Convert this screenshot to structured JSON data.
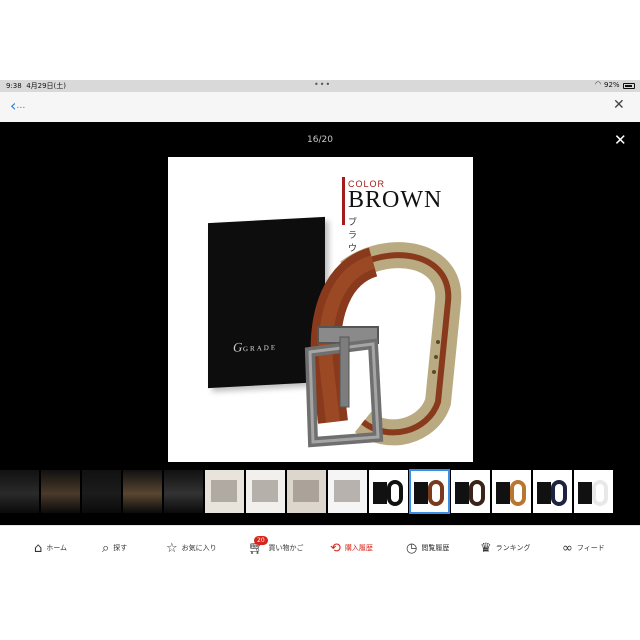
{
  "status_bar": {
    "time": "9:38",
    "date": "4月29日(土)",
    "battery": "92%",
    "battery_level": 0.92
  },
  "nav": {
    "back_label": "‹",
    "more_label": "…",
    "close_label": "✕"
  },
  "viewer": {
    "counter": "16/20",
    "close_label": "✕",
    "product": {
      "color_word": "COLOR",
      "color_name": "BROWN",
      "color_kana": "ブラウン",
      "box_brand": "GRADE",
      "box_brand_initial": "G",
      "colors": {
        "accent": "#a31d1d",
        "belt": "#8a3a1c",
        "buckle": "#7a7a7a"
      }
    },
    "thumbnails": [
      {
        "name": "lifestyle-1"
      },
      {
        "name": "lifestyle-2"
      },
      {
        "name": "lifestyle-3"
      },
      {
        "name": "lifestyle-4"
      },
      {
        "name": "lifestyle-5"
      },
      {
        "name": "detail-1"
      },
      {
        "name": "detail-2"
      },
      {
        "name": "detail-3"
      },
      {
        "name": "detail-4"
      },
      {
        "name": "color-black"
      },
      {
        "name": "color-brown",
        "selected": true
      },
      {
        "name": "color-dark-brown"
      },
      {
        "name": "color-camel"
      },
      {
        "name": "color-navy"
      },
      {
        "name": "color-white"
      }
    ]
  },
  "tabs": [
    {
      "label": "ホーム",
      "icon": "home-icon"
    },
    {
      "label": "探す",
      "icon": "search-icon"
    },
    {
      "label": "お気に入り",
      "icon": "star-icon"
    },
    {
      "label": "買い物かご",
      "icon": "cart-icon",
      "badge": "20"
    },
    {
      "label": "購入履歴",
      "icon": "purchase-history-icon",
      "active": true
    },
    {
      "label": "閲覧履歴",
      "icon": "view-history-icon"
    },
    {
      "label": "ランキング",
      "icon": "crown-icon"
    },
    {
      "label": "フィード",
      "icon": "binoculars-icon"
    }
  ]
}
